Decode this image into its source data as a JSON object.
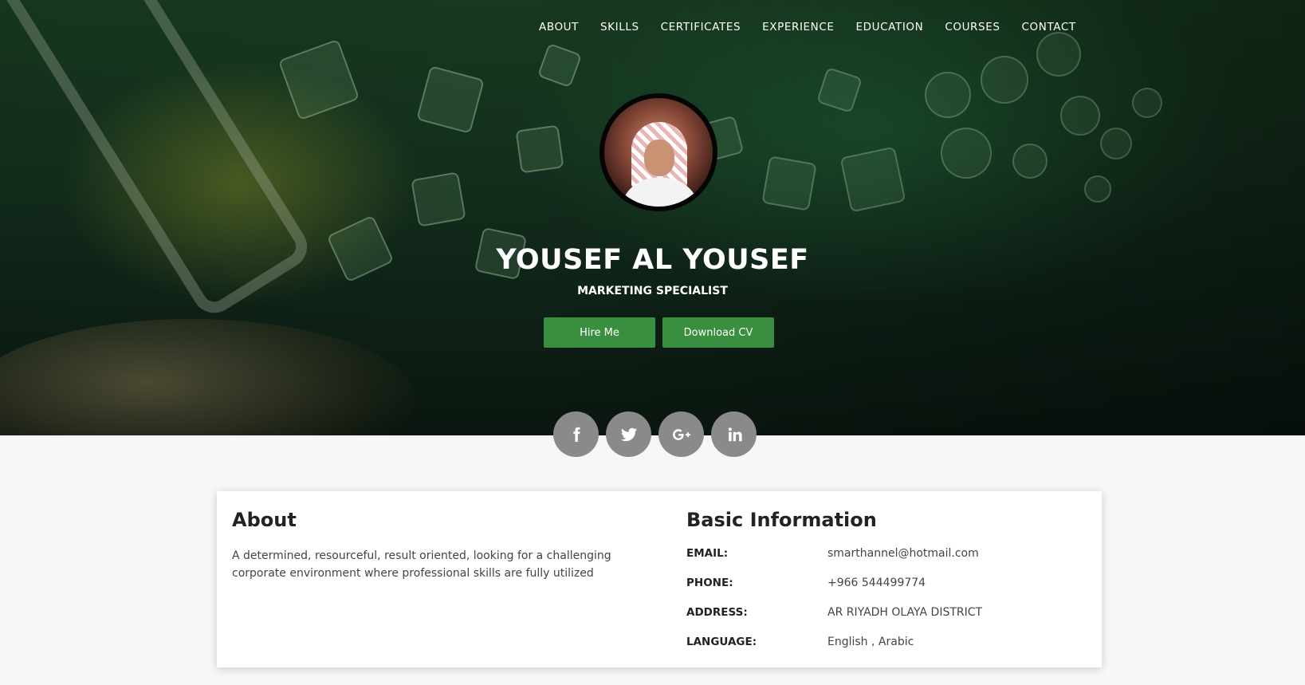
{
  "nav": {
    "items": [
      {
        "label": "ABOUT"
      },
      {
        "label": "SKILLS"
      },
      {
        "label": "CERTIFICATES"
      },
      {
        "label": "EXPERIENCE"
      },
      {
        "label": "EDUCATION"
      },
      {
        "label": "COURSES"
      },
      {
        "label": "CONTACT"
      }
    ]
  },
  "profile": {
    "name": "YOUSEF AL YOUSEF",
    "title": "MARKETING SPECIALIST",
    "hire_label": "Hire Me",
    "cv_label": "Download CV"
  },
  "social": [
    {
      "icon": "facebook-icon"
    },
    {
      "icon": "twitter-icon"
    },
    {
      "icon": "google-plus-icon"
    },
    {
      "icon": "linkedin-icon"
    }
  ],
  "about": {
    "title": "About",
    "text": "A determined, resourceful, result oriented, looking for a challenging corporate environment where professional skills are fully utilized"
  },
  "basic_info": {
    "title": "Basic Information",
    "rows": [
      {
        "label": "EMAIL:",
        "value": "smarthannel@hotmail.com"
      },
      {
        "label": "PHONE:",
        "value": "+966 544499774"
      },
      {
        "label": "ADDRESS:",
        "value": "AR RIYADH OLAYA DISTRICT"
      },
      {
        "label": "LANGUAGE:",
        "value": "English , Arabic"
      }
    ]
  },
  "colors": {
    "accent": "#3a8e3f",
    "social_bg": "#8a8a8a",
    "hero_bg": "#14301d"
  }
}
